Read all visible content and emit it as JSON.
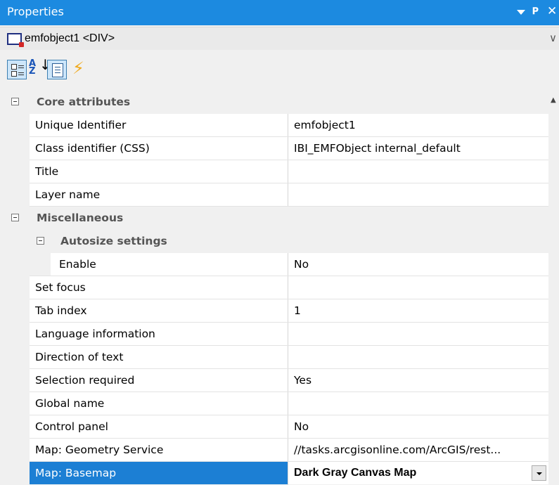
{
  "panel": {
    "title": "Properties"
  },
  "object_selector": {
    "value": "emfobject1 <DIV>"
  },
  "toolbar": {
    "categorized": "categorized-view-icon",
    "alphabetical": "sort-alphabetical-icon",
    "properties": "properties-page-icon",
    "events": "events-lightning-icon"
  },
  "grid": {
    "core": {
      "label": "Core attributes",
      "rows": [
        {
          "name": "Unique Identifier",
          "value": "emfobject1"
        },
        {
          "name": "Class identifier (CSS)",
          "value": "IBI_EMFObject internal_default"
        },
        {
          "name": "Title",
          "value": ""
        },
        {
          "name": "Layer name",
          "value": ""
        }
      ]
    },
    "misc": {
      "label": "Miscellaneous",
      "autosize": {
        "label": "Autosize settings",
        "rows": [
          {
            "name": "Enable",
            "value": "No"
          }
        ]
      },
      "rows": [
        {
          "name": "Set focus",
          "value": ""
        },
        {
          "name": "Tab index",
          "value": "1"
        },
        {
          "name": "Language information",
          "value": ""
        },
        {
          "name": "Direction of text",
          "value": ""
        },
        {
          "name": "Selection required",
          "value": "Yes"
        },
        {
          "name": "Global name",
          "value": ""
        },
        {
          "name": "Control panel",
          "value": "No"
        },
        {
          "name": "Map: Geometry Service",
          "value": "//tasks.arcgisonline.com/ArcGIS/rest..."
        },
        {
          "name": "Map: Basemap",
          "value": "Dark Gray Canvas Map"
        }
      ]
    }
  },
  "colors": {
    "title_bar": "#1c8ae0",
    "selection": "#1c7fd4",
    "events_icon": "#f0a91b"
  }
}
